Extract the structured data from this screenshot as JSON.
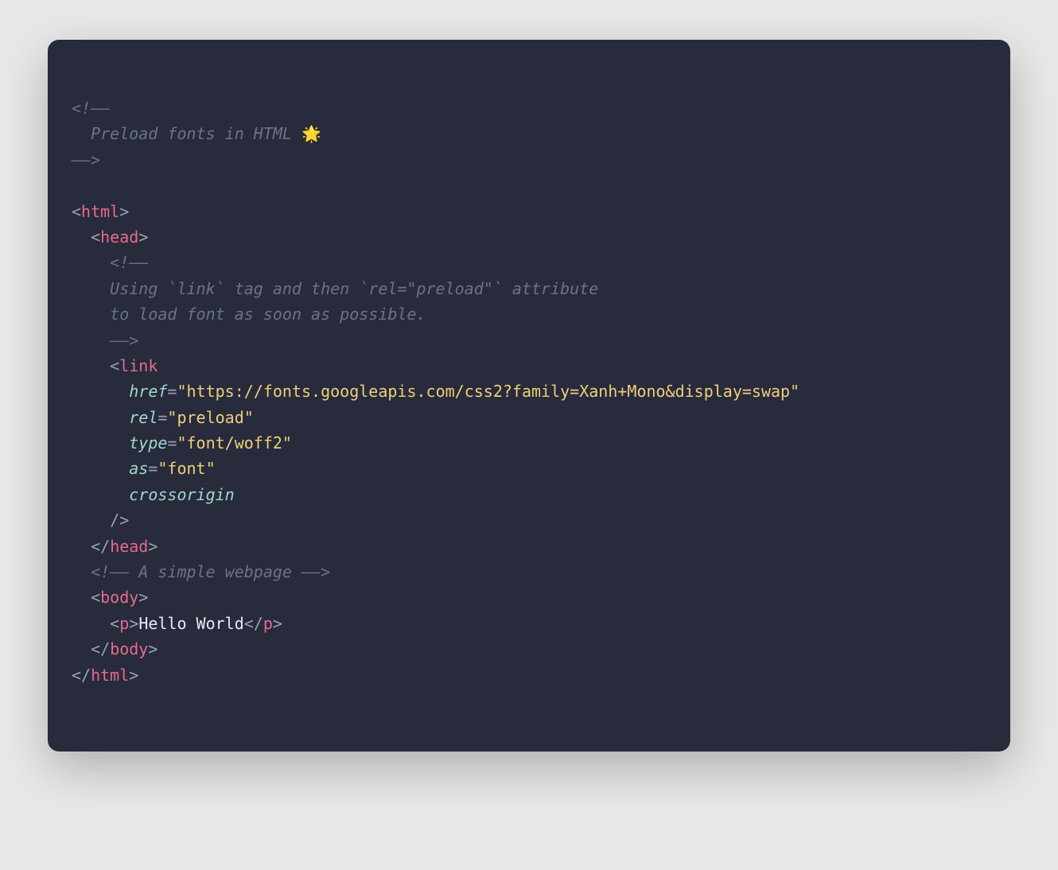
{
  "comment1_open": "<!——",
  "comment1_body": "  Preload fonts in HTML ",
  "comment1_emoji": "🌟",
  "comment1_close": "——>",
  "tag_html_open_lt": "<",
  "tag_html": "html",
  "tag_close_gt": ">",
  "indent1": "  ",
  "indent2": "    ",
  "indent3": "      ",
  "tag_head": "head",
  "comment2_open": "<!——",
  "comment2_line1": "    Using `link` tag and then `rel=\"preload\"` attribute",
  "comment2_line2": "    to load font as soon as possible.",
  "comment2_close": "    ——>",
  "tag_link": "link",
  "attr_href": "href",
  "val_href": "\"https://fonts.googleapis.com/css2?family=Xanh+Mono&display=swap\"",
  "attr_rel": "rel",
  "val_rel": "\"preload\"",
  "attr_type": "type",
  "val_type": "\"font/woff2\"",
  "attr_as": "as",
  "val_as": "\"font\"",
  "attr_crossorigin": "crossorigin",
  "self_close": "/>",
  "close_tag_open": "</",
  "comment3": "<!—— A simple webpage ——>",
  "tag_body": "body",
  "tag_p": "p",
  "text_hello": "Hello World",
  "eq": "="
}
